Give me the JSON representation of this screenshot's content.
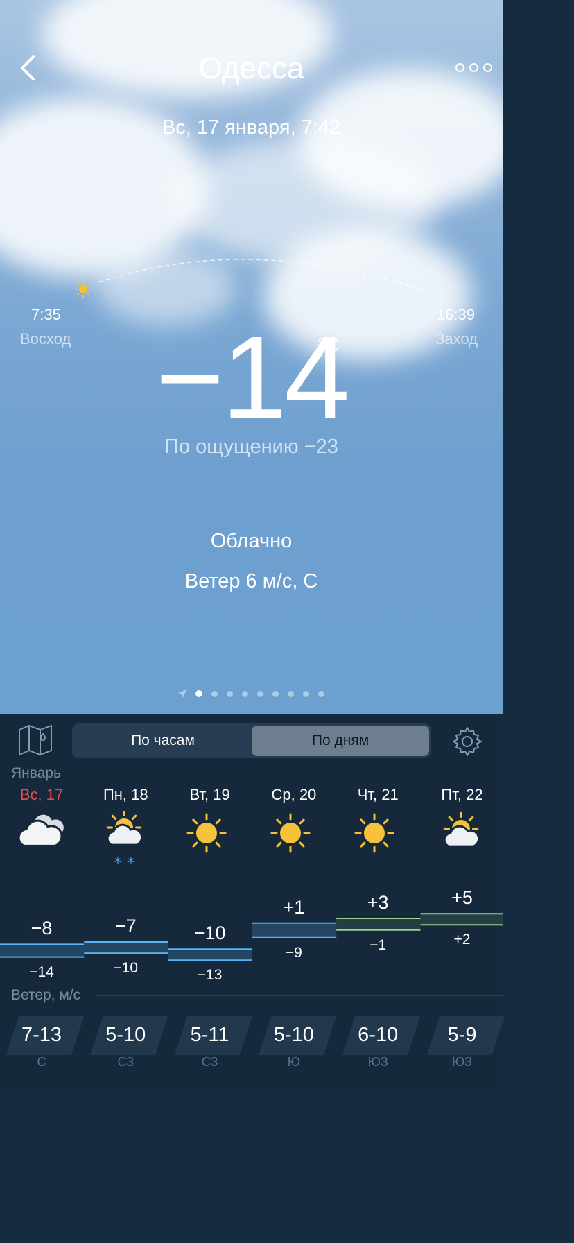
{
  "header": {
    "city": "Одесса",
    "date": "Вс, 17 января, 7:42"
  },
  "sun": {
    "sunrise_time": "7:35",
    "sunrise_label": "Восход",
    "sunset_time": "16:39",
    "sunset_label": "Заход"
  },
  "current": {
    "temperature": "−14",
    "unit": "°C",
    "feels_like": "По ощущению −23",
    "condition": "Облачно",
    "wind": "Ветер 6 м/с, С"
  },
  "pager": {
    "count": 10,
    "active_index": 0
  },
  "panel": {
    "tab_hourly": "По часам",
    "tab_daily": "По дням",
    "active_tab": "daily",
    "month": "Январь",
    "wind_label": "Ветер, м/с"
  },
  "days": [
    {
      "name": "Вс, 17",
      "today": true,
      "icon": "cloudy-icon",
      "high": "−8",
      "low": "−14",
      "wind": "7-13",
      "dir": "С"
    },
    {
      "name": "Пн, 18",
      "today": false,
      "icon": "partly-cloudy-snow-icon",
      "high": "−7",
      "low": "−10",
      "wind": "5-10",
      "dir": "СЗ"
    },
    {
      "name": "Вт, 19",
      "today": false,
      "icon": "sun-icon",
      "high": "−10",
      "low": "−13",
      "wind": "5-11",
      "dir": "СЗ"
    },
    {
      "name": "Ср, 20",
      "today": false,
      "icon": "sun-icon",
      "high": "+1",
      "low": "−9",
      "wind": "5-10",
      "dir": "Ю"
    },
    {
      "name": "Чт, 21",
      "today": false,
      "icon": "sun-icon",
      "high": "+3",
      "low": "−1",
      "wind": "6-10",
      "dir": "ЮЗ"
    },
    {
      "name": "Пт, 22",
      "today": false,
      "icon": "partly-cloudy-icon",
      "high": "+5",
      "low": "+2",
      "wind": "5-9",
      "dir": "ЮЗ"
    }
  ],
  "colors": {
    "cold_line": "#58b4f0",
    "warm_line": "#9ed28a",
    "today": "#e34f4f",
    "sun": "#f5c23a"
  }
}
